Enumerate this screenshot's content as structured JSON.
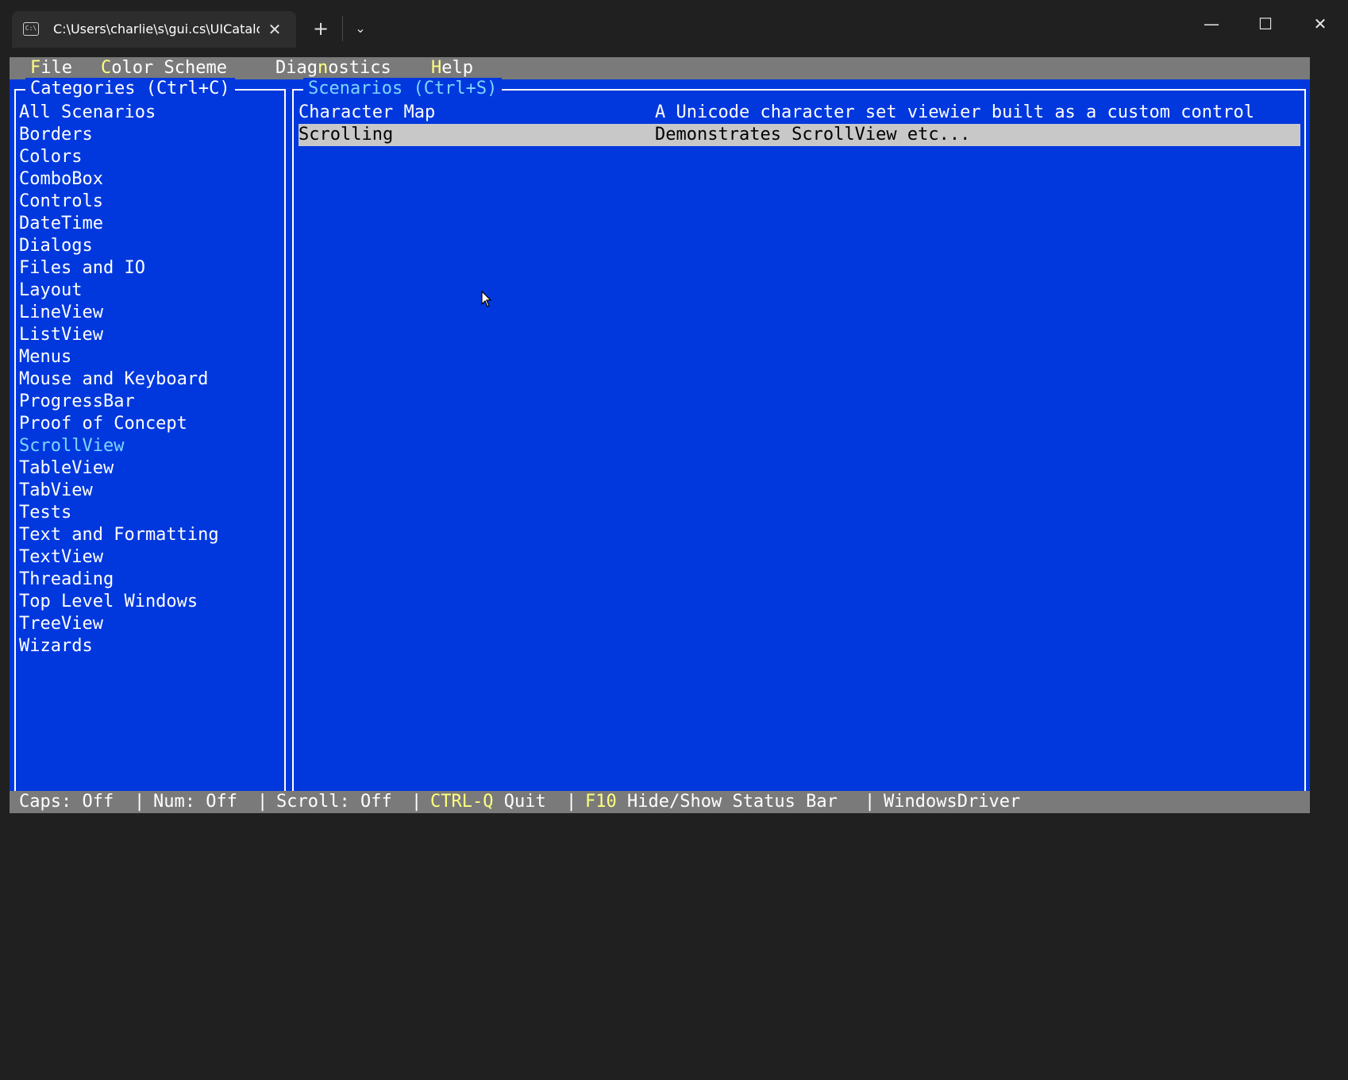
{
  "window": {
    "tab_title": "C:\\Users\\charlie\\s\\gui.cs\\UICatalog",
    "tab_icon_text": "C:\\",
    "tab_close_glyph": "✕",
    "new_tab_glyph": "+",
    "dropdown_glyph": "⌄",
    "minimize_glyph": "—",
    "maximize_glyph": "☐",
    "close_glyph": "✕"
  },
  "menubar": {
    "items": [
      {
        "hotkey": "F",
        "rest": "ile"
      },
      {
        "hotkey": "C",
        "rest": "olor Scheme"
      },
      {
        "pre": "Diag",
        "hotkey": "n",
        "rest": "ostics"
      },
      {
        "hotkey": "H",
        "rest": "elp"
      }
    ]
  },
  "categories": {
    "title": "Categories (Ctrl+C)",
    "items": [
      "All Scenarios",
      "Borders",
      "Colors",
      "ComboBox",
      "Controls",
      "DateTime",
      "Dialogs",
      "Files and IO",
      "Layout",
      "LineView",
      "ListView",
      "Menus",
      "Mouse and Keyboard",
      "ProgressBar",
      "Proof of Concept",
      "ScrollView",
      "TableView",
      "TabView",
      "Tests",
      "Text and Formatting",
      "TextView",
      "Threading",
      "Top Level Windows",
      "TreeView",
      "Wizards"
    ],
    "selected": "ScrollView"
  },
  "scenarios": {
    "title": "Scenarios (Ctrl+S)",
    "rows": [
      {
        "name": "Character Map",
        "description": "A Unicode character set viewier built as a custom control"
      },
      {
        "name": "Scrolling",
        "description": "Demonstrates ScrollView etc..."
      }
    ],
    "selected": "Scrolling"
  },
  "statusbar": {
    "caps": "Caps: Off",
    "num": "Num: Off",
    "scroll": "Scroll: Off",
    "quit_key": "CTRL-Q",
    "quit_label": " Quit",
    "toggle_key": "F10",
    "toggle_label": " Hide/Show Status Bar",
    "driver": "WindowsDriver",
    "separator": "|"
  },
  "colors": {
    "terminal_bg": "#0038de",
    "bar_bg": "#7a7a7a",
    "hotkey": "#ffff80",
    "accent": "#7fd6ff",
    "selection_bg": "#c8c8c8"
  }
}
